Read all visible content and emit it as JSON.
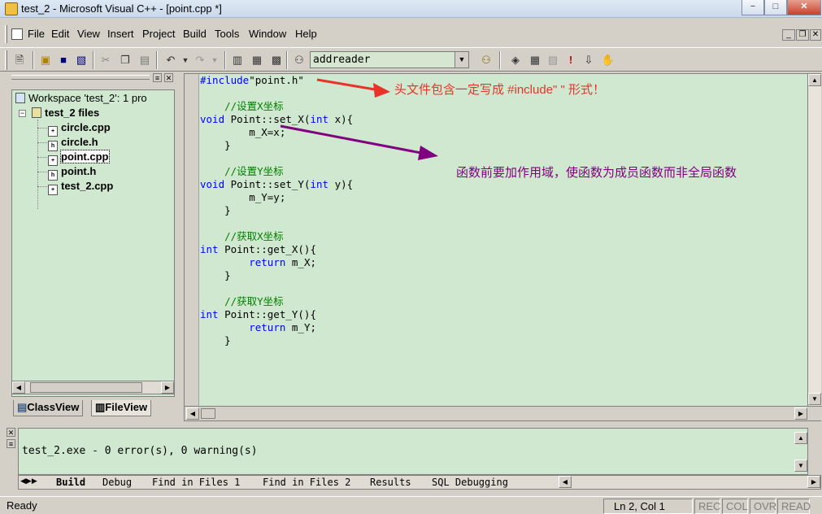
{
  "window": {
    "title": "test_2 - Microsoft Visual C++ - [point.cpp *]",
    "min_label": "−",
    "max_label": "□",
    "close_label": "✕"
  },
  "menu": [
    "File",
    "Edit",
    "View",
    "Insert",
    "Project",
    "Build",
    "Tools",
    "Window",
    "Help"
  ],
  "toolbar": {
    "combo_value": "addreader"
  },
  "workspace": {
    "root": "Workspace 'test_2': 1 pro",
    "project": "test_2 files",
    "files": [
      "circle.cpp",
      "circle.h",
      "point.cpp",
      "point.h",
      "test_2.cpp"
    ],
    "selected_file": "point.cpp",
    "tabs": [
      "ClassView",
      "FileView"
    ]
  },
  "editor": {
    "lines": [
      {
        "t": "#include\"point.h\"",
        "k": "inc"
      },
      {
        "t": "",
        "k": ""
      },
      {
        "t": "    //设置X坐标",
        "k": "cm"
      },
      {
        "t": "void Point::set_X(int x){",
        "k": "fn",
        "kw": "void",
        "rest": " Point::set_X(",
        "kw2": "int",
        "rest2": " x){"
      },
      {
        "t": "        m_X=x;",
        "k": ""
      },
      {
        "t": "    }",
        "k": ""
      },
      {
        "t": "",
        "k": ""
      },
      {
        "t": "    //设置Y坐标",
        "k": "cm"
      },
      {
        "t": "void Point::set_Y(int y){",
        "k": "fn",
        "kw": "void",
        "rest": " Point::set_Y(",
        "kw2": "int",
        "rest2": " y){"
      },
      {
        "t": "        m_Y=y;",
        "k": ""
      },
      {
        "t": "    }",
        "k": ""
      },
      {
        "t": "",
        "k": ""
      },
      {
        "t": "    //获取X坐标",
        "k": "cm"
      },
      {
        "t": "int Point::get_X(){",
        "k": "fn",
        "kw": "int",
        "rest": " Point::get_X(){",
        "kw2": "",
        "rest2": ""
      },
      {
        "t": "        return m_X;",
        "k": "ret",
        "kw": "return",
        "rest": " m_X;"
      },
      {
        "t": "    }",
        "k": ""
      },
      {
        "t": "",
        "k": ""
      },
      {
        "t": "    //获取Y坐标",
        "k": "cm"
      },
      {
        "t": "int Point::get_Y(){",
        "k": "fn",
        "kw": "int",
        "rest": " Point::get_Y(){",
        "kw2": "",
        "rest2": ""
      },
      {
        "t": "        return m_Y;",
        "k": "ret",
        "kw": "return",
        "rest": " m_Y;"
      },
      {
        "t": "    }",
        "k": ""
      }
    ],
    "note1": "头文件包含一定写成 #include\" \" 形式！",
    "note2": "函数前要加作用域，使函数为成员函数而非全局函数",
    "note1_color": "#e8332a",
    "note2_color": "#800080"
  },
  "output": {
    "text": "test_2.exe - 0 error(s), 0 warning(s)",
    "tabs": [
      "Build",
      "Debug",
      "Find in Files 1",
      "Find in Files 2",
      "Results",
      "SQL Debugging"
    ]
  },
  "status": {
    "ready": "Ready",
    "position": "Ln 2, Col 1",
    "rec": "REC",
    "col": "COL",
    "ovr": "OVR",
    "read": "READ"
  }
}
